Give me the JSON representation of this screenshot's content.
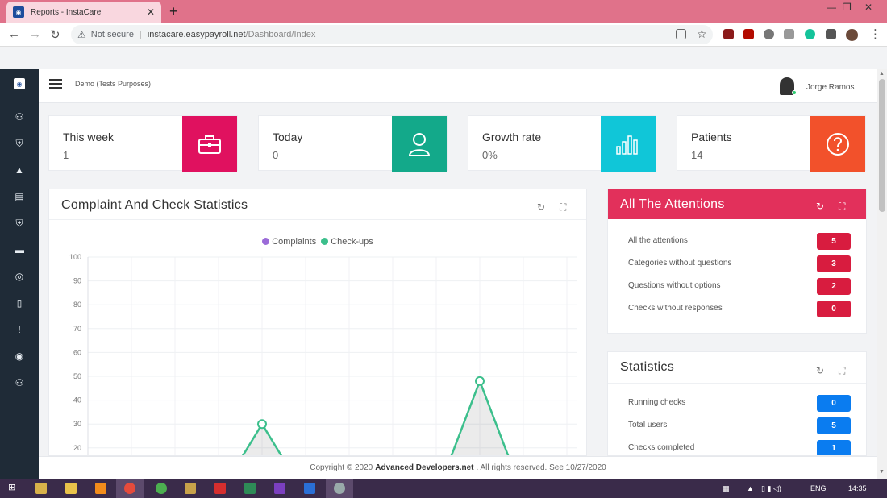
{
  "browser": {
    "tab_title": "Reports - InstaCare",
    "security_label": "Not secure",
    "url_host": "instacare.easypayroll.net",
    "url_path": "/Dashboard/Index"
  },
  "header": {
    "company": "Demo (Tests Purposes)",
    "user_name": "Jorge Ramos"
  },
  "stats": [
    {
      "title": "This week",
      "value": "1",
      "color": "#e0115f",
      "icon": "briefcase-icon"
    },
    {
      "title": "Today",
      "value": "0",
      "color": "#13a98a",
      "icon": "user-icon"
    },
    {
      "title": "Growth rate",
      "value": "0%",
      "color": "#10c6d8",
      "icon": "bar-chart-icon"
    },
    {
      "title": "Patients",
      "value": "14",
      "color": "#f2512b",
      "icon": "question-icon"
    }
  ],
  "complaints_panel": {
    "title": "Complaint And Check Statistics"
  },
  "attentions_panel": {
    "title": "All The Attentions",
    "items": [
      {
        "label": "All the attentions",
        "count": "5"
      },
      {
        "label": "Categories without questions",
        "count": "3"
      },
      {
        "label": "Questions without options",
        "count": "2"
      },
      {
        "label": "Checks without responses",
        "count": "0"
      }
    ],
    "badge_color": "#d81c3f"
  },
  "statistics_panel": {
    "title": "Statistics",
    "items": [
      {
        "label": "Running checks",
        "count": "0"
      },
      {
        "label": "Total users",
        "count": "5"
      },
      {
        "label": "Checks completed",
        "count": "1"
      }
    ],
    "badge_color": "#0a7cf0"
  },
  "footer": {
    "prefix": "Copyright © 2020",
    "company": "Advanced Developers.net",
    "suffix": ". All rights reserved. See 10/27/2020"
  },
  "taskbar": {
    "language": "ENG",
    "time": "14:35"
  },
  "chart_data": {
    "type": "line",
    "title": "",
    "legend": [
      "Complaints",
      "Check-ups"
    ],
    "legend_position": "top-center",
    "series": [
      {
        "name": "Complaints",
        "color": "#9b6bd8",
        "values": []
      },
      {
        "name": "Check-ups",
        "color": "#3cbf8c",
        "points": [
          {
            "x": 4,
            "y": 30
          },
          {
            "x": 9,
            "y": 48
          }
        ]
      }
    ],
    "y_ticks": [
      100,
      90,
      80,
      70,
      60,
      50,
      40,
      30,
      20
    ],
    "ylim": [
      0,
      100
    ],
    "grid": true
  }
}
